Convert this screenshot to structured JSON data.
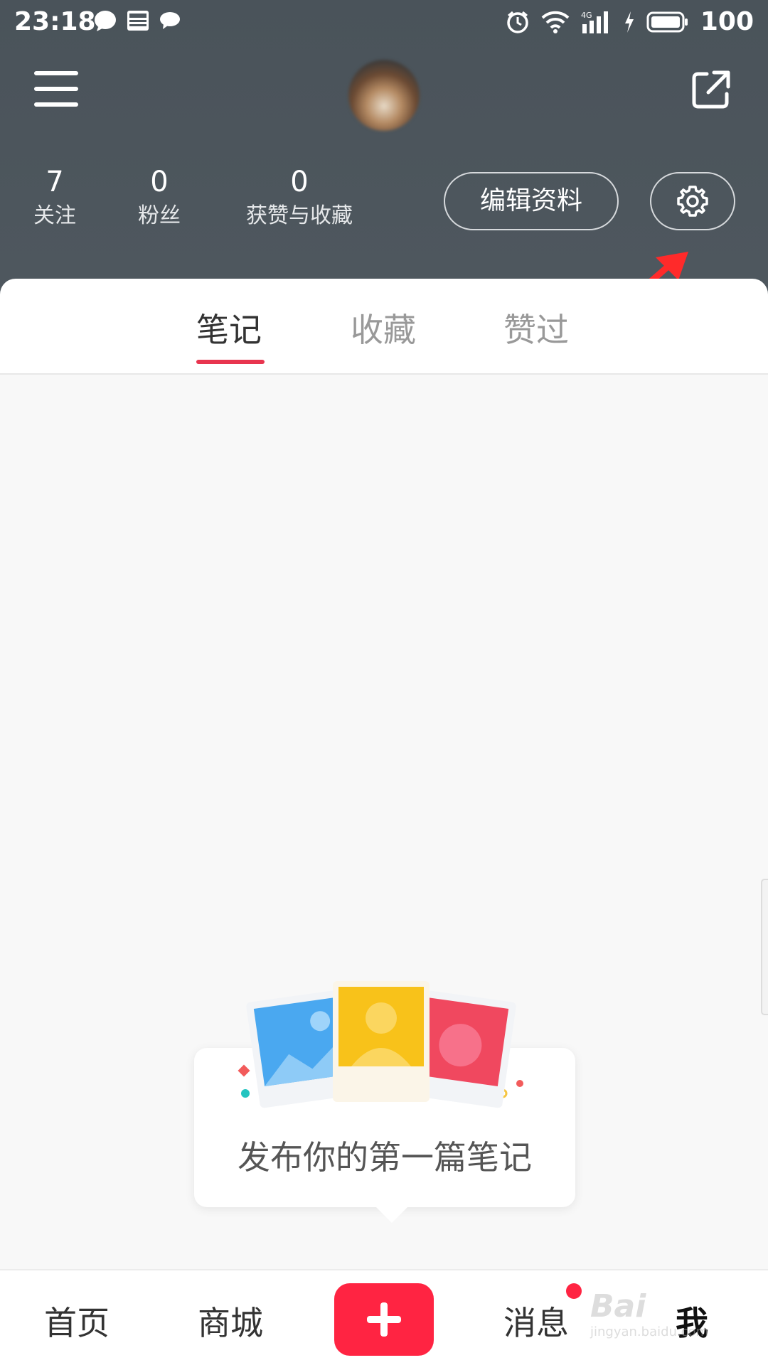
{
  "status_bar": {
    "time": "23:18",
    "battery": "100",
    "icons": [
      "chat-bubble-icon",
      "news-icon",
      "message-icon",
      "alarm-icon",
      "wifi-icon",
      "signal-4g-icon",
      "charging-icon",
      "battery-icon"
    ]
  },
  "topbar": {
    "menu_icon": "hamburger-menu-icon",
    "share_icon": "share-icon"
  },
  "stats": [
    {
      "value": "7",
      "label": "关注"
    },
    {
      "value": "0",
      "label": "粉丝"
    },
    {
      "value": "0",
      "label": "获赞与收藏"
    }
  ],
  "actions": {
    "edit_profile": "编辑资料",
    "settings_icon": "gear-icon"
  },
  "tabs": [
    {
      "label": "笔记",
      "active": true
    },
    {
      "label": "收藏",
      "active": false
    },
    {
      "label": "赞过",
      "active": false
    }
  ],
  "empty_state": {
    "text": "发布你的第一篇笔记"
  },
  "bottom_nav": {
    "home": "首页",
    "mall": "商城",
    "add_icon": "plus-icon",
    "messages": "消息",
    "me": "我"
  },
  "watermark": {
    "brand": "Bai",
    "sub": "jingyan.baidu.com"
  },
  "colors": {
    "accent": "#ff2442",
    "header": "#4d565d",
    "tab_underline": "#e8354f"
  }
}
